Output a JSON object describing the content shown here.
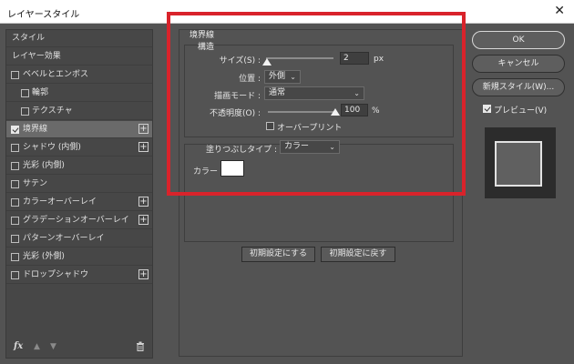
{
  "window": {
    "title": "レイヤースタイル",
    "close": "✕"
  },
  "left_panel": {
    "items": [
      {
        "label": "スタイル",
        "checkbox": false,
        "checked": false,
        "plus": false,
        "selected": false,
        "indent": false
      },
      {
        "label": "レイヤー効果",
        "checkbox": false,
        "checked": false,
        "plus": false,
        "selected": false,
        "indent": false
      },
      {
        "label": "ベベルとエンボス",
        "checkbox": true,
        "checked": false,
        "plus": false,
        "selected": false,
        "indent": false
      },
      {
        "label": "輪郭",
        "checkbox": true,
        "checked": false,
        "plus": false,
        "selected": false,
        "indent": true
      },
      {
        "label": "テクスチャ",
        "checkbox": true,
        "checked": false,
        "plus": false,
        "selected": false,
        "indent": true
      },
      {
        "label": "境界線",
        "checkbox": true,
        "checked": true,
        "plus": true,
        "selected": true,
        "indent": false
      },
      {
        "label": "シャドウ (内側)",
        "checkbox": true,
        "checked": false,
        "plus": true,
        "selected": false,
        "indent": false
      },
      {
        "label": "光彩 (内側)",
        "checkbox": true,
        "checked": false,
        "plus": false,
        "selected": false,
        "indent": false
      },
      {
        "label": "サテン",
        "checkbox": true,
        "checked": false,
        "plus": false,
        "selected": false,
        "indent": false
      },
      {
        "label": "カラーオーバーレイ",
        "checkbox": true,
        "checked": false,
        "plus": true,
        "selected": false,
        "indent": false
      },
      {
        "label": "グラデーションオーバーレイ",
        "checkbox": true,
        "checked": false,
        "plus": true,
        "selected": false,
        "indent": false
      },
      {
        "label": "パターンオーバーレイ",
        "checkbox": true,
        "checked": false,
        "plus": false,
        "selected": false,
        "indent": false
      },
      {
        "label": "光彩 (外側)",
        "checkbox": true,
        "checked": false,
        "plus": false,
        "selected": false,
        "indent": false
      },
      {
        "label": "ドロップシャドウ",
        "checkbox": true,
        "checked": false,
        "plus": true,
        "selected": false,
        "indent": false
      }
    ],
    "footer": {
      "fx": "fx",
      "up": "▲",
      "down": "▼",
      "trash": "🗑"
    }
  },
  "stroke": {
    "title": "境界線",
    "structure_label": "構造",
    "size": {
      "label": "サイズ(S) :",
      "value": "2",
      "unit": "px",
      "slider_fraction": 0.02
    },
    "position": {
      "label": "位置 :",
      "value": "外側"
    },
    "blend_mode": {
      "label": "描画モード :",
      "value": "通常"
    },
    "opacity": {
      "label": "不透明度(O) :",
      "value": "100",
      "unit": "%",
      "slider_fraction": 1.0
    },
    "overprint": {
      "label": "オーバープリント",
      "checked": false
    },
    "fill_type": {
      "label": "塗りつぶしタイプ :",
      "value": "カラー"
    },
    "color": {
      "label": "カラー :",
      "swatch": "#ffffff"
    },
    "buttons": {
      "make_default": "初期設定にする",
      "reset_default": "初期設定に戻す"
    }
  },
  "right": {
    "ok": "OK",
    "cancel": "キャンセル",
    "new_style": "新規スタイル(W)...",
    "preview": {
      "label": "プレビュー(V)",
      "checked": true
    }
  },
  "colors": {
    "highlight": "#d9232b",
    "panel": "#535353"
  },
  "icons": {
    "close": "close-icon",
    "chevron": "chevron-down-icon",
    "plus": "plus-icon",
    "trash": "trash-icon",
    "fx": "fx-icon"
  }
}
